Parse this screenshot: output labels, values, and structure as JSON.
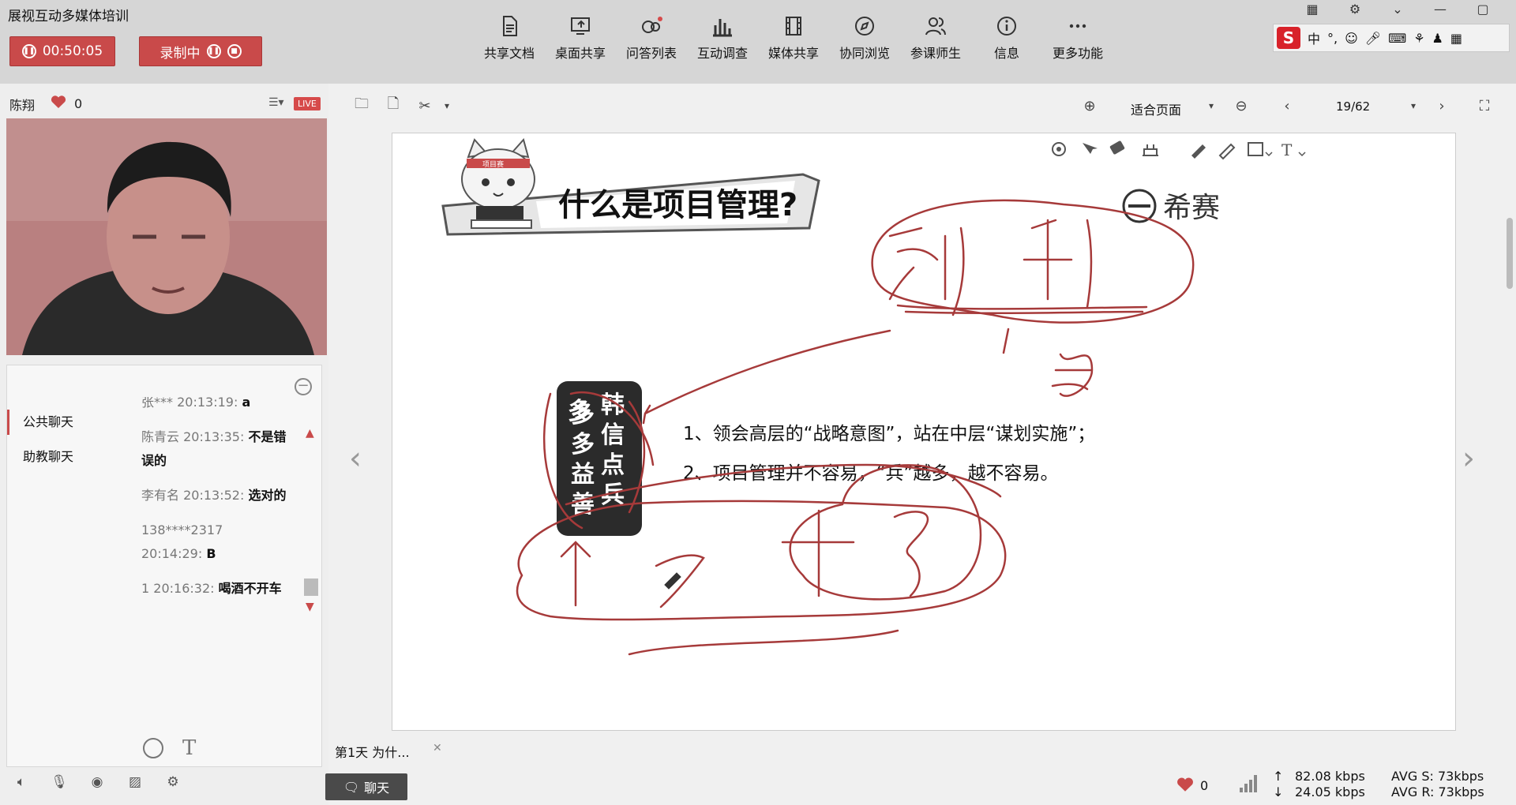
{
  "app": {
    "title": "展视互动多媒体培训",
    "timer": "00:50:05",
    "record_label": "录制中"
  },
  "toolbar": {
    "items": [
      {
        "label": "共享文档",
        "icon": "document-icon"
      },
      {
        "label": "桌面共享",
        "icon": "desktop-share-icon"
      },
      {
        "label": "问答列表",
        "icon": "qa-list-icon"
      },
      {
        "label": "互动调查",
        "icon": "survey-chart-icon"
      },
      {
        "label": "媒体共享",
        "icon": "media-film-icon"
      },
      {
        "label": "协同浏览",
        "icon": "compass-icon"
      },
      {
        "label": "参课师生",
        "icon": "participants-icon"
      },
      {
        "label": "信息",
        "icon": "info-icon"
      },
      {
        "label": "更多功能",
        "icon": "more-dots-icon"
      }
    ]
  },
  "ime": {
    "mode": "中",
    "punct": "°,"
  },
  "presenter": {
    "name": "陈翔",
    "likes": "0",
    "live": "LIVE"
  },
  "chat": {
    "tabs": [
      "公共聊天",
      "助教聊天"
    ],
    "messages": [
      {
        "who": "张***",
        "time": "20:13:19:",
        "text": "a"
      },
      {
        "who": "陈青云",
        "time": "20:13:35:",
        "text": "不是错误的"
      },
      {
        "who": "李有名",
        "time": "20:13:52:",
        "text": "选对的"
      },
      {
        "who": "138****2317",
        "time": "20:14:29:",
        "text": "B"
      },
      {
        "who": "1",
        "time": "20:16:32:",
        "text": "喝酒不开车"
      }
    ]
  },
  "viewer": {
    "zoom": "适合页面",
    "page": "19/62",
    "tab_title": "第1天 为什...",
    "chat_button": "聊天"
  },
  "slide": {
    "title": "什么是项目管理?",
    "brand": "希赛",
    "badge_left": "多多益善",
    "badge_right": "韩信点兵",
    "point1": "1、领会高层的“战略意图”，站在中层“谋划实施”；",
    "point2": "2、项目管理并不容易，“兵”越多，越不容易。",
    "mascot_band": "项目赛"
  },
  "stats": {
    "likes": "0",
    "up": "82.08 kbps",
    "down": "24.05 kbps",
    "avg_s": "AVG S: 73kbps",
    "avg_r": "AVG R: 73kbps"
  },
  "colors": {
    "accent": "#c94a4a",
    "toolbar_bg": "#d6d6d6",
    "annotation": "#a63a3a"
  }
}
